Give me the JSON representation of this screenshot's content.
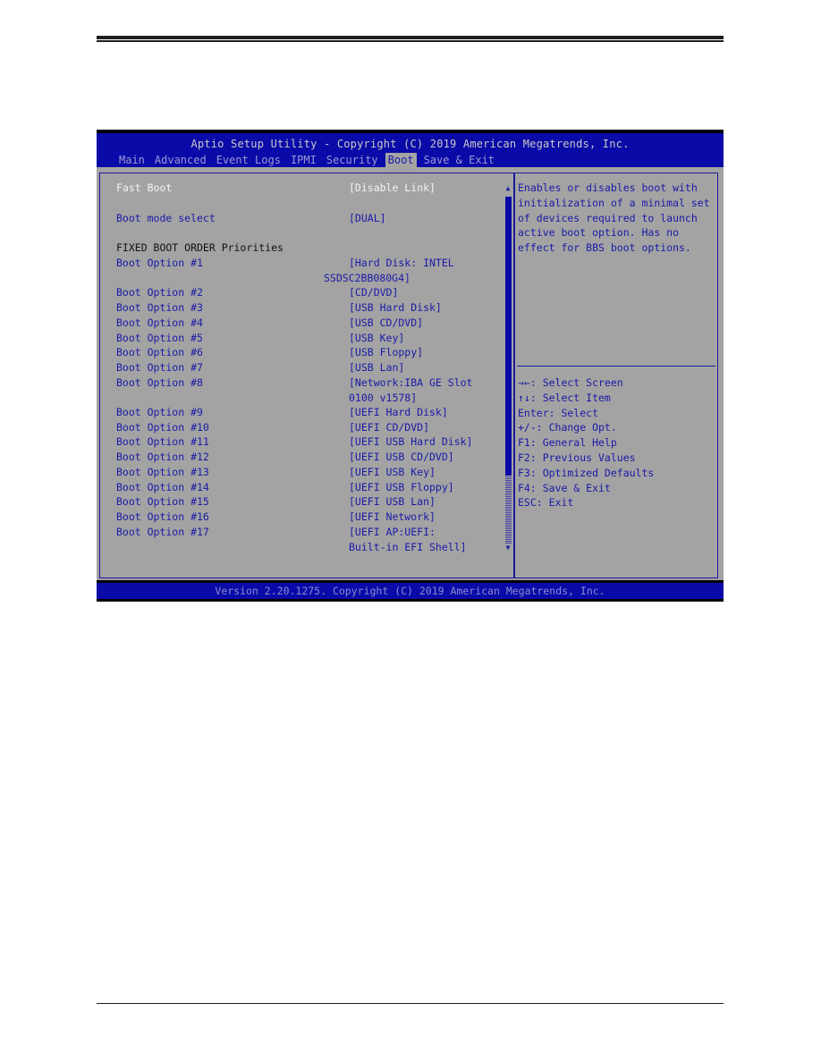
{
  "header": {
    "title": "Aptio Setup Utility - Copyright (C) 2019 American Megatrends, Inc."
  },
  "tabs": [
    {
      "label": "Main",
      "active": false
    },
    {
      "label": "Advanced",
      "active": false
    },
    {
      "label": "Event Logs",
      "active": false
    },
    {
      "label": "IPMI",
      "active": false
    },
    {
      "label": "Security",
      "active": false
    },
    {
      "label": "Boot",
      "active": true
    },
    {
      "label": "Save & Exit",
      "active": false
    }
  ],
  "settings": {
    "fast_boot": {
      "label": "Fast Boot",
      "value": "[Disable Link]"
    },
    "boot_mode_select": {
      "label": "Boot mode select",
      "value": "[DUAL]"
    },
    "fixed_boot_order_heading": "FIXED BOOT ORDER Priorities",
    "boot_options": [
      {
        "label": "Boot Option #1",
        "value": "[Hard Disk: INTEL",
        "value2": "SSDSC2BB080G4]"
      },
      {
        "label": "Boot Option #2",
        "value": "[CD/DVD]"
      },
      {
        "label": "Boot Option #3",
        "value": "[USB Hard Disk]"
      },
      {
        "label": "Boot Option #4",
        "value": "[USB CD/DVD]"
      },
      {
        "label": "Boot Option #5",
        "value": "[USB Key]"
      },
      {
        "label": "Boot Option #6",
        "value": "[USB Floppy]"
      },
      {
        "label": "Boot Option #7",
        "value": "[USB Lan]"
      },
      {
        "label": "Boot Option #8",
        "value": "[Network:IBA GE Slot",
        "value2": "0100 v1578]"
      },
      {
        "label": "Boot Option #9",
        "value": "[UEFI Hard Disk]"
      },
      {
        "label": "Boot Option #10",
        "value": "[UEFI CD/DVD]"
      },
      {
        "label": "Boot Option #11",
        "value": "[UEFI USB Hard Disk]"
      },
      {
        "label": "Boot Option #12",
        "value": "[UEFI USB CD/DVD]"
      },
      {
        "label": "Boot Option #13",
        "value": "[UEFI USB Key]"
      },
      {
        "label": "Boot Option #14",
        "value": "[UEFI USB Floppy]"
      },
      {
        "label": "Boot Option #15",
        "value": "[UEFI USB Lan]"
      },
      {
        "label": "Boot Option #16",
        "value": "[UEFI Network]"
      },
      {
        "label": "Boot Option #17",
        "value": "[UEFI AP:UEFI:",
        "value2": "Built-in EFI Shell]"
      }
    ]
  },
  "scrollbar": {
    "up_icon": "▲",
    "down_icon": "▼",
    "thumb_fraction": 0.8
  },
  "help": {
    "description": "Enables or disables boot with initialization of a minimal set of devices required to launch active boot option. Has no effect for BBS boot options.",
    "keys": [
      "→←: Select Screen",
      "↑↓: Select Item",
      "Enter: Select",
      "+/-: Change Opt.",
      "F1: General Help",
      "F2: Previous Values",
      "F3: Optimized Defaults",
      "F4: Save & Exit",
      "ESC: Exit"
    ]
  },
  "footer": {
    "text": "Version 2.20.1275. Copyright (C) 2019 American Megatrends, Inc."
  }
}
